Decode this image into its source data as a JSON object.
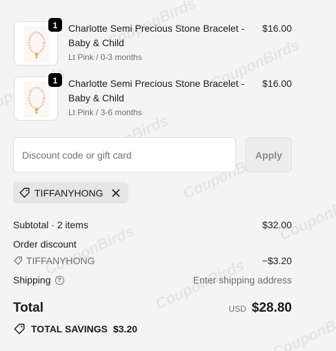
{
  "line_items": [
    {
      "quantity": "1",
      "title": "Charlotte Semi Precious Stone Bracelet - Baby & Child",
      "variant": "Lt Pink / 0-3 months",
      "price": "$16.00",
      "image_icon": "bracelet-image"
    },
    {
      "quantity": "1",
      "title": "Charlotte Semi Precious Stone Bracelet - Baby & Child",
      "variant": "Lt Pink / 3-6 months",
      "price": "$16.00",
      "image_icon": "bracelet-image"
    }
  ],
  "discount": {
    "placeholder": "Discount code or gift card",
    "value": "",
    "apply_label": "Apply"
  },
  "applied_code": {
    "code": "TIFFANYHONG",
    "icon": "tag-icon",
    "remove_icon": "close-icon"
  },
  "summary": {
    "subtotal_label": "Subtotal · 2 items",
    "subtotal_value": "$32.00",
    "order_discount_label": "Order discount",
    "discount_code": "TIFFANYHONG",
    "discount_value": "−$3.20",
    "shipping_label": "Shipping",
    "shipping_value": "Enter shipping address",
    "total_label": "Total",
    "currency": "USD",
    "total_value": "$28.80",
    "savings_label": "TOTAL SAVINGS",
    "savings_value": "$3.20"
  },
  "watermark": "CouponBirds",
  "colors": {
    "background": "#f4f4f4",
    "badge": "#000000",
    "chip": "#e5e5e5",
    "muted_text": "#6e6e6e"
  }
}
